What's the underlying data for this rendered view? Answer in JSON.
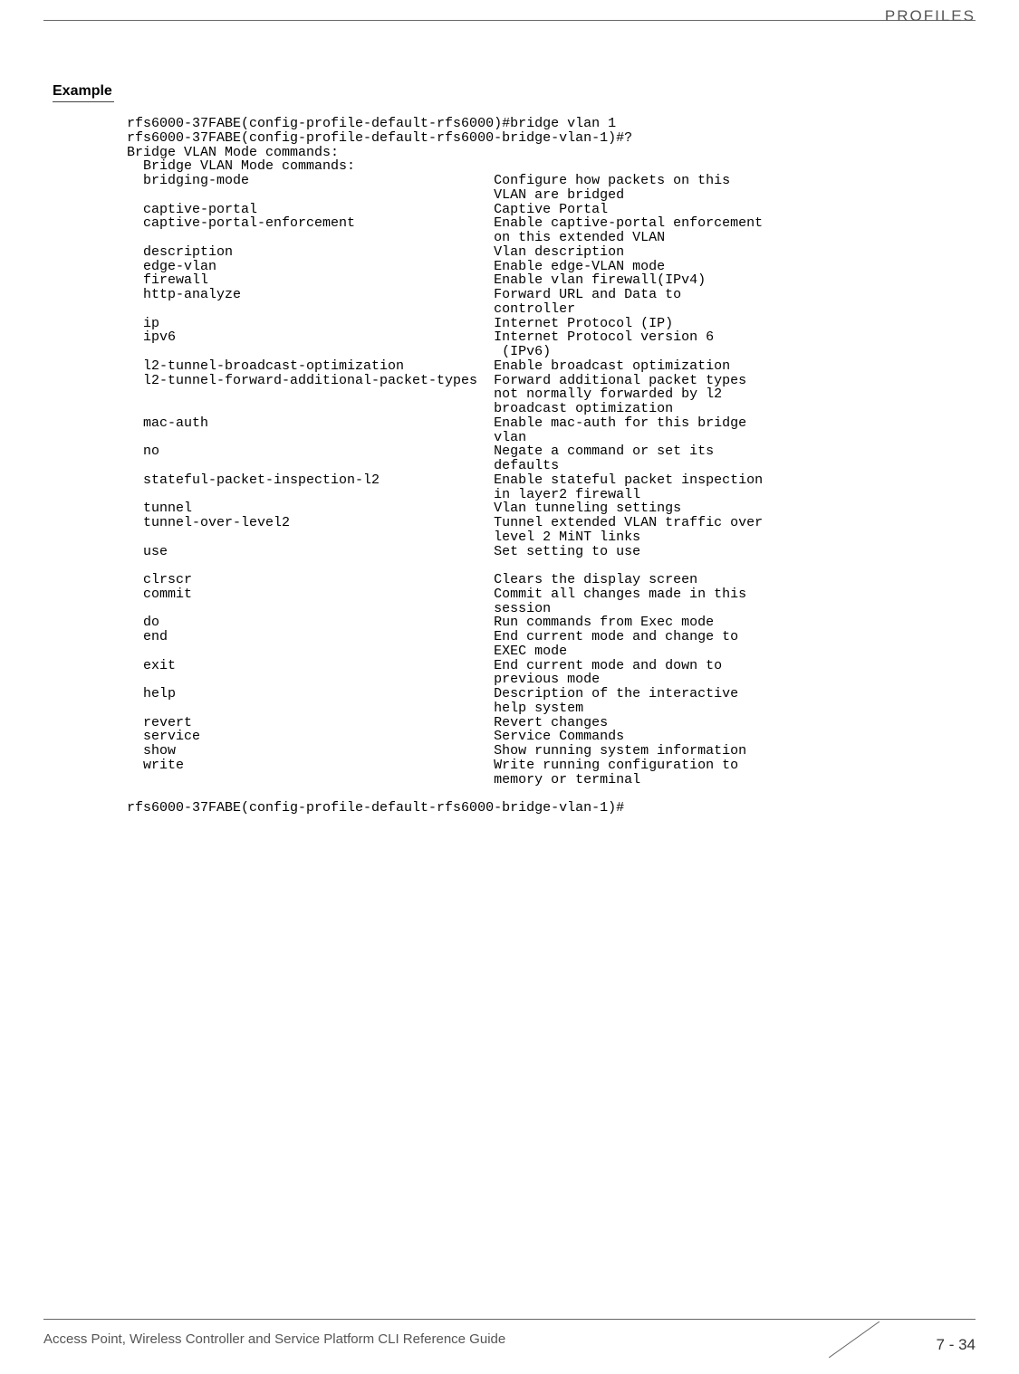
{
  "header": {
    "category": "PROFILES"
  },
  "section": {
    "heading": "Example"
  },
  "cli": {
    "line1": "rfs6000-37FABE(config-profile-default-rfs6000)#bridge vlan 1",
    "line2": "rfs6000-37FABE(config-profile-default-rfs6000-bridge-vlan-1)#?",
    "line3": "Bridge VLAN Mode commands:",
    "line4": "  Bridge VLAN Mode commands:",
    "commands": [
      {
        "name": "bridging-mode",
        "desc": [
          "Configure how packets on this",
          "VLAN are bridged"
        ]
      },
      {
        "name": "captive-portal",
        "desc": [
          "Captive Portal"
        ]
      },
      {
        "name": "captive-portal-enforcement",
        "desc": [
          "Enable captive-portal enforcement",
          "on this extended VLAN"
        ]
      },
      {
        "name": "description",
        "desc": [
          "Vlan description"
        ]
      },
      {
        "name": "edge-vlan",
        "desc": [
          "Enable edge-VLAN mode"
        ]
      },
      {
        "name": "firewall",
        "desc": [
          "Enable vlan firewall(IPv4)"
        ]
      },
      {
        "name": "http-analyze",
        "desc": [
          "Forward URL and Data to",
          "controller"
        ]
      },
      {
        "name": "ip",
        "desc": [
          "Internet Protocol (IP)"
        ]
      },
      {
        "name": "ipv6",
        "desc": [
          "Internet Protocol version 6",
          " (IPv6)"
        ]
      },
      {
        "name": "l2-tunnel-broadcast-optimization",
        "desc": [
          "Enable broadcast optimization"
        ]
      },
      {
        "name": "l2-tunnel-forward-additional-packet-types",
        "desc": [
          "Forward additional packet types",
          "not normally forwarded by l2",
          "broadcast optimization"
        ]
      },
      {
        "name": "mac-auth",
        "desc": [
          "Enable mac-auth for this bridge",
          "vlan"
        ]
      },
      {
        "name": "no",
        "desc": [
          "Negate a command or set its",
          "defaults"
        ]
      },
      {
        "name": "stateful-packet-inspection-l2",
        "desc": [
          "Enable stateful packet inspection",
          "in layer2 firewall"
        ]
      },
      {
        "name": "tunnel",
        "desc": [
          "Vlan tunneling settings"
        ]
      },
      {
        "name": "tunnel-over-level2",
        "desc": [
          "Tunnel extended VLAN traffic over",
          "level 2 MiNT links"
        ]
      },
      {
        "name": "use",
        "desc": [
          "Set setting to use"
        ]
      }
    ],
    "commands2": [
      {
        "name": "clrscr",
        "desc": [
          "Clears the display screen"
        ]
      },
      {
        "name": "commit",
        "desc": [
          "Commit all changes made in this",
          "session"
        ]
      },
      {
        "name": "do",
        "desc": [
          "Run commands from Exec mode"
        ]
      },
      {
        "name": "end",
        "desc": [
          "End current mode and change to",
          "EXEC mode"
        ]
      },
      {
        "name": "exit",
        "desc": [
          "End current mode and down to",
          "previous mode"
        ]
      },
      {
        "name": "help",
        "desc": [
          "Description of the interactive",
          "help system"
        ]
      },
      {
        "name": "revert",
        "desc": [
          "Revert changes"
        ]
      },
      {
        "name": "service",
        "desc": [
          "Service Commands"
        ]
      },
      {
        "name": "show",
        "desc": [
          "Show running system information"
        ]
      },
      {
        "name": "write",
        "desc": [
          "Write running configuration to",
          "memory or terminal"
        ]
      }
    ],
    "promptend": "rfs6000-37FABE(config-profile-default-rfs6000-bridge-vlan-1)#"
  },
  "footer": {
    "left": "Access Point, Wireless Controller and Service Platform CLI Reference Guide",
    "pagenum": "7 - 34"
  },
  "layout": {
    "descCol": 45,
    "indent": "  "
  }
}
